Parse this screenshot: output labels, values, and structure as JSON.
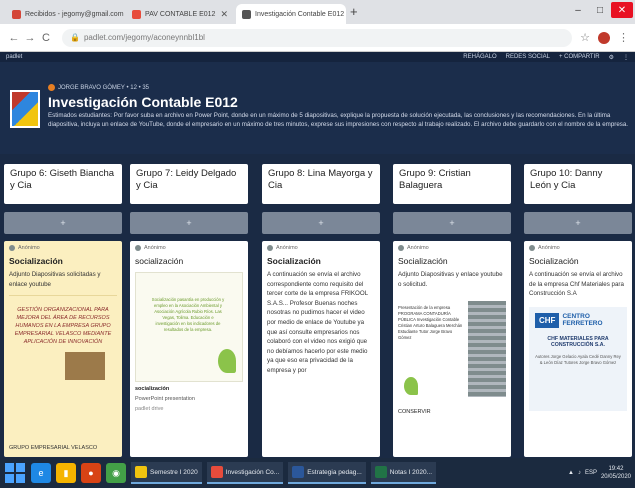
{
  "browser": {
    "tabs": [
      {
        "label": "Recibidos - jegomy@gmail.com",
        "fav_color": "#d44638"
      },
      {
        "label": "PAV CONTABLE E012",
        "fav_color": "#e74c3c"
      },
      {
        "label": "Investigación Contable E012",
        "fav_color": "#555555"
      }
    ],
    "new_tab": "+",
    "minimize": "–",
    "maximize": "□",
    "close": "✕",
    "url": "padlet.com/jegomy/aconeynnbl1bl",
    "back": "←",
    "forward": "→",
    "reload": "C"
  },
  "padlet_header": {
    "brand": "padlet",
    "remake": "REHÁGALO",
    "share_social": "REDES SOCIAL",
    "share": "+ COMPARTIR",
    "settings_icon": "gear-icon"
  },
  "board": {
    "author": "JORGE BRAVO GÓMEY • 12 • 35",
    "title": "Investigación Contable E012",
    "description": "Estimados estudiantes: Por favor suba en archivo en Power Point, donde en un máximo de 5 diapositivas, explique la propuesta de solución ejecutada, las conclusiones y las recomendaciones. En la última diapositiva, incluya un enlace de YouTube, donde el empresario en un máximo de tres minutos, exprese sus impresiones con respecto al trabajo realizado. El archivo debe guardarlo con el nombre de la empresa."
  },
  "columns": [
    {
      "title": "Grupo 6: Giseth Biancha y Cia",
      "add": "+",
      "card": {
        "author": "Anónimo",
        "title": "Socialización",
        "body": "Adjunto Diapositivas solicitadas y enlace youtube",
        "image_text": "GESTIÓN ORGANIZACIONAL PARA MEJORA DEL ÁREA DE RECURSOS HUMANOS EN LA EMPRESA GRUPO EMPRESARIAL VELASCO MEDIANTE APLICACIÓN DE INNOVACIÓN",
        "footer": "GRUPO EMPRESARIAL VELASCO"
      }
    },
    {
      "title": "Grupo 7: Leidy Delgado y Cia",
      "add": "+",
      "card": {
        "author": "Anónimo",
        "title": "socialización",
        "slide_text": "Socialización pasantía en producción y empleo en la Asociación Ambiental y Asociación Agrícola Rubio Ríos. Las Vegas, Tolima. Educación e investigación en los indicadores de resultados de la empresa.",
        "footer_title": "socialización",
        "footer_sub": "PowerPoint presentation",
        "footer_link": "padlet drive"
      }
    },
    {
      "title": "Grupo 8: Lina Mayorga y Cia",
      "add": "+",
      "card": {
        "author": "Anónimo",
        "title": "Socialización",
        "body": "A continuación se envía el archivo correspondiente como requisito del tercer corte de la empresa FRIKOOL S.A.S... Profesor Buenas noches nosotras no pudimos hacer el video por medio de enlace de Youtube ya que así consulte empresarios nos colaboró con el video nos exigió que no debíamos hacerlo por este medio ya que eso era privacidad de la empresa y por"
      }
    },
    {
      "title": "Grupo 9: Cristian Balaguera",
      "add": "+",
      "card": {
        "author": "Anónimo",
        "title": "Socialización",
        "body": "Adjunto Diapositivas y enlace youtube o solicitud.",
        "slide_text": "Presentación de la empresa PROGRAMA CONTADURÍA PÚBLICA Investigación Contable Cristian Arturo Balaguera Merchán Estudiante Tutor Jorge Bravo Gómez",
        "footer": "CONSERVIR"
      }
    },
    {
      "title": "Grupo 10: Danny León y Cia",
      "add": "+",
      "card": {
        "author": "Anónimo",
        "title": "Socialización",
        "body": "A continuación se envía el archivo de la empresa Chf Materiales para Construcción S.A",
        "logo_box": "CHF",
        "logo_text": "CENTRO FERRETERO",
        "logo_caption": "CHF MATERIALES PARA CONSTRUCCIÓN S.A.",
        "logo_detail": "Autores Jorge Gelacio Ayala Cedé Danny Rey & León Díaz Tutores Jorge Bravo Gómez"
      }
    }
  ],
  "taskbar": {
    "apps": [
      {
        "label": "Semestre I 2020",
        "color": "#f1c40f"
      },
      {
        "label": "Investigación Co...",
        "color": "#e74c3c"
      },
      {
        "label": "Estrategia pedag...",
        "color": "#2b579a"
      },
      {
        "label": "Notas I 2020...",
        "color": "#217346"
      }
    ],
    "lang": "ESP",
    "time": "19:42",
    "date": "20/05/2020"
  },
  "colors": {
    "board_bg": "#1b2d4b",
    "accent": "#6fa8dc"
  }
}
